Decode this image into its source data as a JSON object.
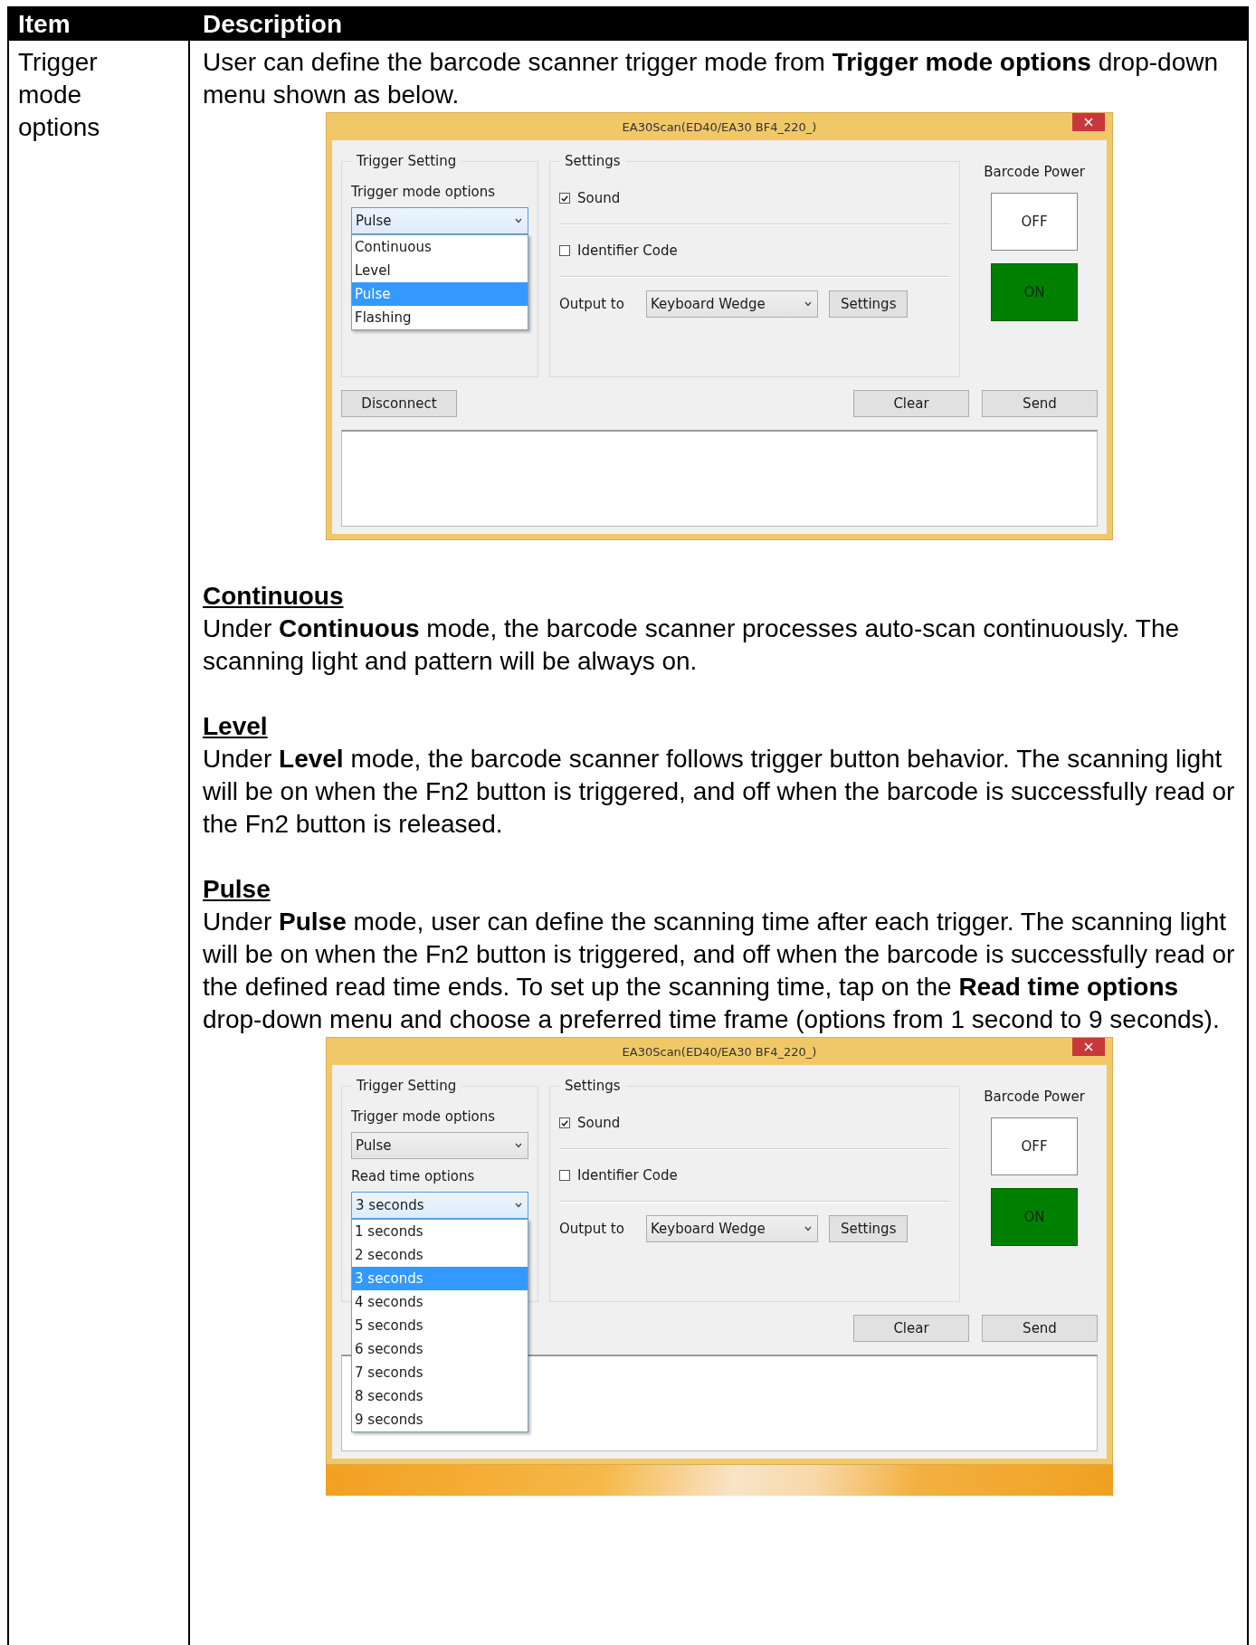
{
  "table": {
    "columns": [
      "Item",
      "Description"
    ],
    "rows": [
      {
        "item": "Trigger mode options",
        "blocks": [
          {
            "kind": "paragraph",
            "text": "User can define the barcode scanner trigger mode from **Trigger mode options** drop-down menu shown as below."
          },
          {
            "kind": "window",
            "title": "EA30Scan(ED40/EA30 BF4_220_)",
            "trigger_group": "Trigger Setting",
            "dropdowns": [
              {
                "label": "Trigger mode options",
                "value": "Pulse",
                "expanded": true,
                "options": [
                  {
                    "label": "Continuous",
                    "selected": false
                  },
                  {
                    "label": "Level",
                    "selected": false
                  },
                  {
                    "label": "Pulse",
                    "selected": true
                  },
                  {
                    "label": "Flashing",
                    "selected": false
                  }
                ]
              }
            ],
            "settings_group": "Settings",
            "checkboxes": [
              {
                "label": "Sound",
                "checked": true
              },
              {
                "label": "Identifier Code",
                "checked": false
              }
            ],
            "output_label": "Output to",
            "output_value": "Keyboard Wedge",
            "settings_button": "Settings",
            "power_label": "Barcode Power",
            "power_buttons": [
              {
                "label": "OFF",
                "selected": false
              },
              {
                "label": "ON",
                "selected": true
              }
            ],
            "disconnect_button": "Disconnect",
            "buttons": [
              "Clear",
              "Send"
            ],
            "desktop_strip": false
          },
          {
            "kind": "section",
            "heading": "Continuous",
            "text": "Under **Continuous** mode, the barcode scanner processes auto-scan continuously. The scanning light and pattern will be always on."
          },
          {
            "kind": "section",
            "heading": "Level",
            "text": "Under **Level** mode, the barcode scanner follows trigger button behavior. The scanning light will be on when the Fn2 button is triggered, and off when the barcode is successfully read or the Fn2 button is released."
          },
          {
            "kind": "section",
            "heading": "Pulse",
            "text": "Under **Pulse** mode, user can define the scanning time after each trigger. The scanning light will be on when the Fn2 button is triggered, and off when the barcode is successfully read or the defined read time ends. To set up the scanning time, tap on the **Read time options** drop-down menu and choose a preferred time frame (options from 1 second to 9 seconds)."
          },
          {
            "kind": "window",
            "title": "EA30Scan(ED40/EA30 BF4_220_)",
            "trigger_group": "Trigger Setting",
            "dropdowns": [
              {
                "label": "Trigger mode options",
                "value": "Pulse",
                "expanded": false
              },
              {
                "label": "Read time options",
                "value": "3 seconds",
                "expanded": true,
                "options": [
                  {
                    "label": "1 seconds",
                    "selected": false
                  },
                  {
                    "label": "2 seconds",
                    "selected": false
                  },
                  {
                    "label": "3 seconds",
                    "selected": true
                  },
                  {
                    "label": "4 seconds",
                    "selected": false
                  },
                  {
                    "label": "5 seconds",
                    "selected": false
                  },
                  {
                    "label": "6 seconds",
                    "selected": false
                  },
                  {
                    "label": "7 seconds",
                    "selected": false
                  },
                  {
                    "label": "8 seconds",
                    "selected": false
                  },
                  {
                    "label": "9 seconds",
                    "selected": false
                  }
                ]
              }
            ],
            "settings_group": "Settings",
            "checkboxes": [
              {
                "label": "Sound",
                "checked": true
              },
              {
                "label": "Identifier Code",
                "checked": false
              }
            ],
            "output_label": "Output to",
            "output_value": "Keyboard Wedge",
            "settings_button": "Settings",
            "power_label": "Barcode Power",
            "power_buttons": [
              {
                "label": "OFF",
                "selected": false
              },
              {
                "label": "ON",
                "selected": true
              }
            ],
            "buttons": [
              "Clear",
              "Send"
            ],
            "desktop_strip": true
          }
        ]
      }
    ]
  }
}
